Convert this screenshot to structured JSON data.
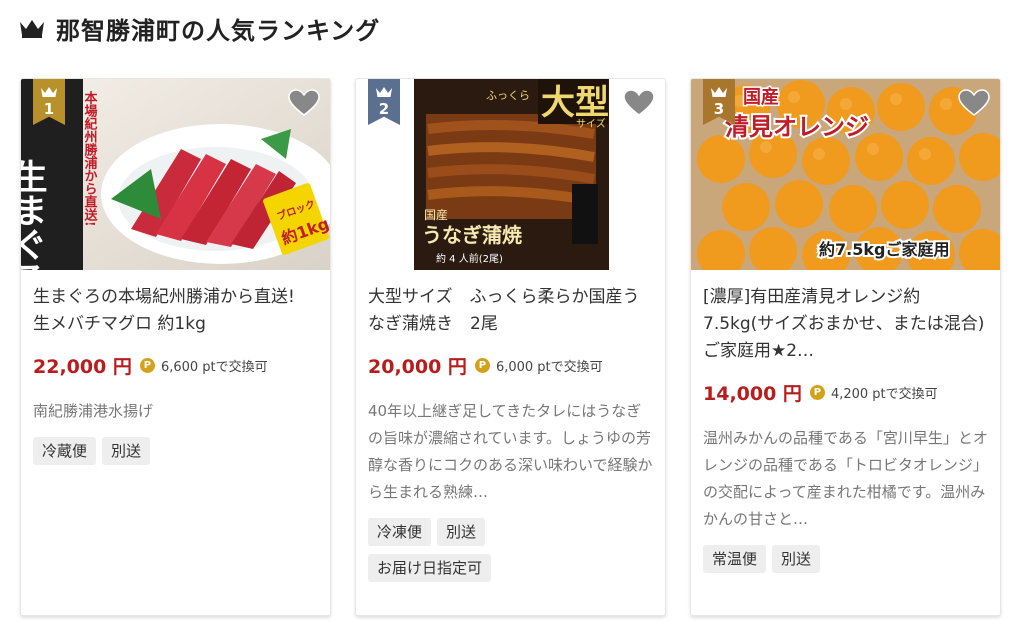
{
  "header": {
    "title": "那智勝浦町の人気ランキング"
  },
  "cards": [
    {
      "rank": "1",
      "title": "生まぐろの本場紀州勝浦から直送!　生メバチマグロ 約1kg",
      "price": "22,000 円",
      "points": "6,600 ptで交換可",
      "description": "南紀勝浦港水揚げ",
      "tags": [
        "冷蔵便",
        "別送"
      ],
      "image_overlay": {
        "vertical_text": "本場紀州勝浦から直送!",
        "big_text": "生まぐろ",
        "block": "ブロック",
        "weight": "約1kg"
      }
    },
    {
      "rank": "2",
      "title": "大型サイズ　ふっくら柔らか国産うなぎ蒲焼き　2尾",
      "price": "20,000 円",
      "points": "6,000 ptで交換可",
      "description": "40年以上継ぎ足してきたタレにはうなぎの旨味が濃縮されています。しょうゆの芳醇な香りにコクのある深い味わいで経験から生まれる熟練…",
      "tags": [
        "冷凍便",
        "別送",
        "お届け日指定可"
      ],
      "image_overlay": {
        "big": "大型",
        "fluffy": "ふっくら",
        "size": "サイズ",
        "domestic": "国産",
        "eel": "うなぎ蒲焼",
        "servings": "約 4 人前(2尾)"
      }
    },
    {
      "rank": "3",
      "title": "[濃厚]有田産清見オレンジ約7.5kg(サイズおまかせ、または混合)ご家庭用★2…",
      "price": "14,000 円",
      "points": "4,200 ptで交換可",
      "description": "温州みかんの品種である「宮川早生」とオレンジの品種である「トロビタオレンジ」の交配によって産まれた柑橘です。温州みかんの甘さと…",
      "tags": [
        "常温便",
        "別送"
      ],
      "image_overlay": {
        "origin": "国産",
        "name": "清見オレンジ",
        "weight": "約7.5kgご家庭用"
      }
    }
  ],
  "icons": {
    "header": "crown-icon",
    "favorite": "heart-icon",
    "points": "point-icon"
  },
  "colors": {
    "price": "#b91c1c",
    "rank_1": "#b8912a",
    "rank_2": "#5b7090",
    "rank_3": "#a8762d",
    "point": "#d4a11a"
  }
}
